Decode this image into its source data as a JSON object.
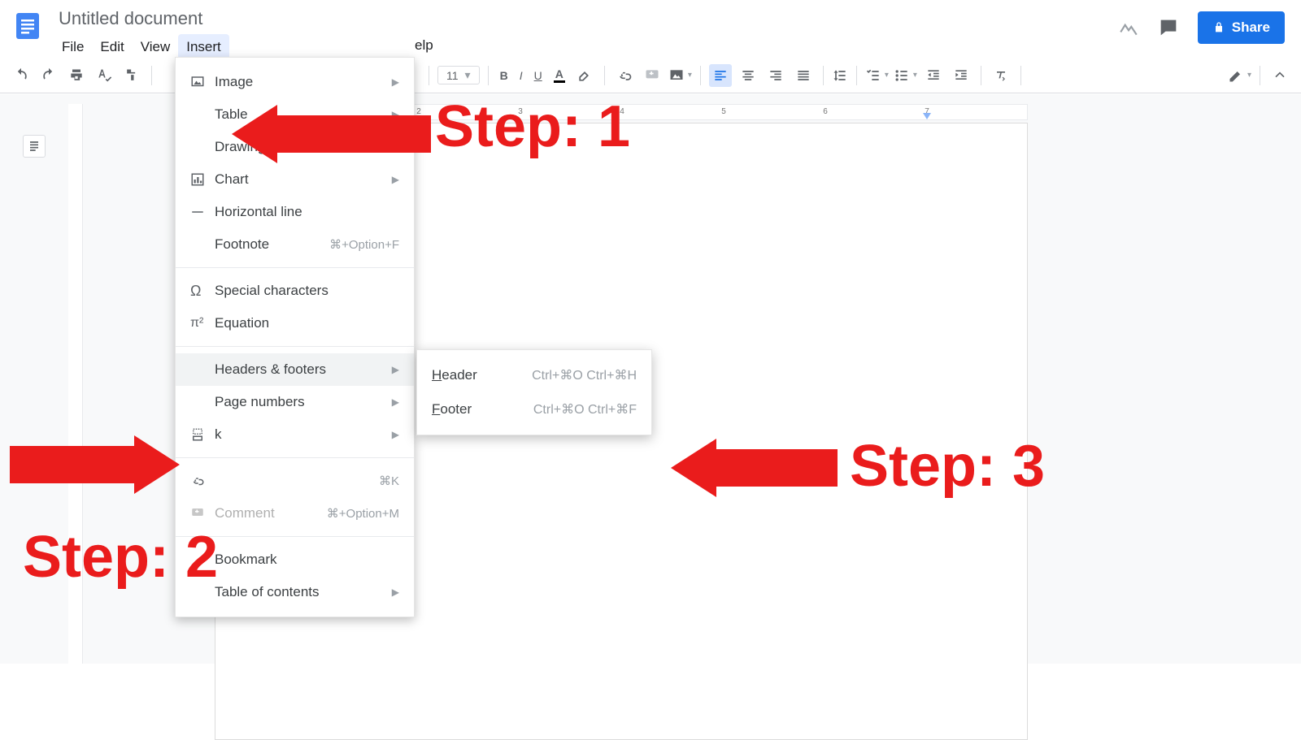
{
  "doc": {
    "title": "Untitled document"
  },
  "menubar": {
    "file": "File",
    "edit": "Edit",
    "view": "View",
    "insert": "Insert",
    "help_partial": "elp"
  },
  "titlebar": {
    "share": "Share"
  },
  "toolbar": {
    "font_size": "11",
    "text_color_letter": "A"
  },
  "ruler": {
    "n2": "2",
    "n3": "3",
    "n4": "4",
    "n5": "5",
    "n6": "6",
    "n7": "7"
  },
  "insert_menu": {
    "image": "Image",
    "table": "Table",
    "drawing": "Drawing",
    "chart": "Chart",
    "horizontal_line": "Horizontal line",
    "footnote": "Footnote",
    "footnote_sc": "⌘+Option+F",
    "special_chars": "Special characters",
    "equation": "Equation",
    "headers_footers": "Headers & footers",
    "page_numbers": "Page numbers",
    "break_partial": "k",
    "link_partial": "",
    "link_sc": "⌘K",
    "comment": "Comment",
    "comment_sc": "⌘+Option+M",
    "bookmark": "Bookmark",
    "toc": "Table of contents"
  },
  "submenu": {
    "header_first": "H",
    "header_rest": "eader",
    "header_sc": "Ctrl+⌘O Ctrl+⌘H",
    "footer_first": "F",
    "footer_rest": "ooter",
    "footer_sc": "Ctrl+⌘O Ctrl+⌘F"
  },
  "annotations": {
    "step1": "Step: 1",
    "step2": "Step: 2",
    "step3": "Step: 3"
  }
}
